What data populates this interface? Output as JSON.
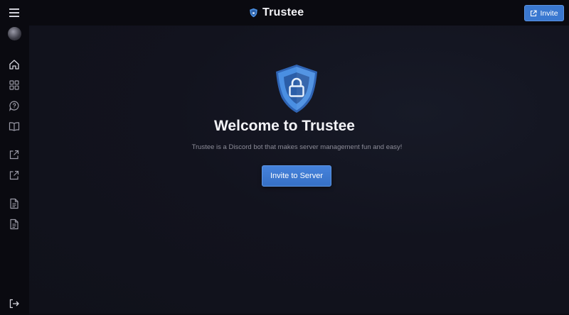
{
  "header": {
    "brand_title": "Trustee",
    "invite_label": "Invite"
  },
  "sidebar": {
    "items": [
      {
        "name": "home",
        "icon": "home-icon"
      },
      {
        "name": "dashboard",
        "icon": "grid-icon"
      },
      {
        "name": "support",
        "icon": "help-chat-icon"
      },
      {
        "name": "docs",
        "icon": "book-icon"
      },
      {
        "name": "external-1",
        "icon": "external-link-icon"
      },
      {
        "name": "external-2",
        "icon": "external-link-icon"
      },
      {
        "name": "terms",
        "icon": "document-icon"
      },
      {
        "name": "privacy",
        "icon": "document-icon"
      },
      {
        "name": "logout",
        "icon": "logout-icon"
      }
    ]
  },
  "hero": {
    "title": "Welcome to Trustee",
    "subtitle": "Trustee is a Discord bot that makes server management fun and easy!",
    "button_label": "Invite to Server"
  },
  "colors": {
    "accent": "#3a78d0",
    "background": "#10111a",
    "bar": "#0a0a10"
  }
}
